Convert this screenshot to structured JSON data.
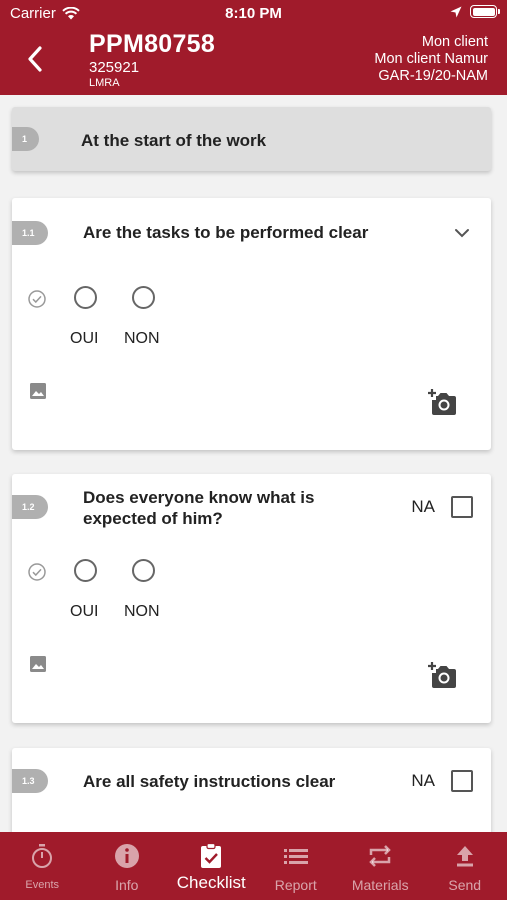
{
  "status_bar": {
    "carrier": "Carrier",
    "time": "8:10 PM"
  },
  "header": {
    "title": "PPM80758",
    "subtitle": "325921",
    "tag": "LMRA",
    "client_name": "Mon client",
    "client_location": "Mon client Namur",
    "client_code": "GAR-19/20-NAM"
  },
  "section": {
    "number": "1",
    "title": "At the start of the work"
  },
  "questions": [
    {
      "number": "1.1",
      "text": "Are the tasks to be performed clear",
      "opt_yes": "OUI",
      "opt_no": "NON"
    },
    {
      "number": "1.2",
      "text": "Does everyone know what is expected of him?",
      "na_label": "NA",
      "opt_yes": "OUI",
      "opt_no": "NON"
    },
    {
      "number": "1.3",
      "text": "Are all safety instructions clear",
      "na_label": "NA"
    }
  ],
  "tabs": [
    {
      "label": "Events",
      "icon": "stopwatch-icon"
    },
    {
      "label": "Info",
      "icon": "info-icon"
    },
    {
      "label": "Checklist",
      "icon": "clipboard-check-icon"
    },
    {
      "label": "Report",
      "icon": "list-icon"
    },
    {
      "label": "Materials",
      "icon": "swap-icon"
    },
    {
      "label": "Send",
      "icon": "upload-icon"
    }
  ],
  "colors": {
    "primary": "#a01b2b",
    "background": "#f2f2f2",
    "pill": "#b0b0b0"
  }
}
